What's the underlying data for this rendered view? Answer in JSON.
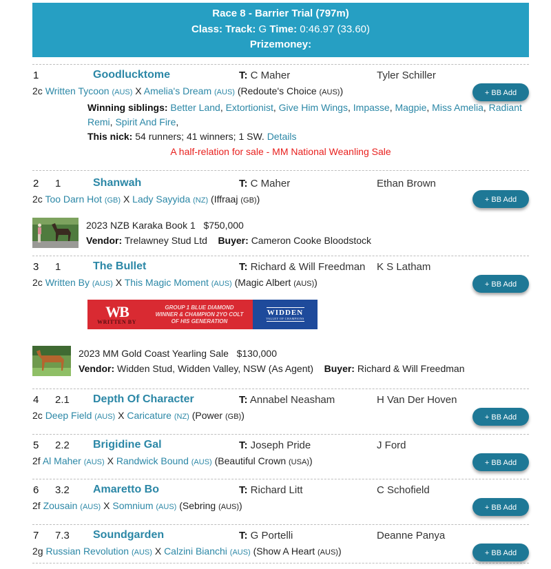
{
  "race": {
    "title": "Race 8 - Barrier Trial (797m)",
    "class_label": "Class:",
    "track_label": "Track:",
    "track_value": "G",
    "time_label": "Time:",
    "time_value": "0:46.97 (33.60)",
    "prizemoney_label": "Prizemoney:"
  },
  "labels": {
    "trainer_prefix": "T:",
    "bb_add": "+ BB Add",
    "cross": "X",
    "winning_siblings": "Winning siblings:",
    "this_nick": "This nick:",
    "details": "Details",
    "vendor": "Vendor:",
    "buyer": "Buyer:"
  },
  "colors": {
    "header_bg": "#269fc3",
    "link": "#2b87a6",
    "button_bg": "#1e7896",
    "sale_note": "#e8201e"
  },
  "runners": [
    {
      "position": "1",
      "margin": "",
      "horse": "Goodlucktome",
      "trainer": "C Maher",
      "jockey": "Tyler Schiller",
      "age_sex": "2c",
      "sire": "Written Tycoon",
      "sire_country": "(AUS)",
      "dam": "Amelia's Dream",
      "dam_country": "(AUS)",
      "damsire": "Redoute's Choice",
      "damsire_country": "(AUS)",
      "siblings": [
        "Better Land",
        "Extortionist",
        "Give Him Wings",
        "Impasse",
        "Magpie",
        "Miss Amelia",
        "Radiant Remi",
        "Spirit And Fire"
      ],
      "nick": "54 runners; 41 winners; 1 SW.",
      "sale_note": "A half-relation for sale - MM National Weanling Sale"
    },
    {
      "position": "2",
      "margin": "1",
      "horse": "Shanwah",
      "trainer": "C Maher",
      "jockey": "Ethan Brown",
      "age_sex": "2c",
      "sire": "Too Darn Hot",
      "sire_country": "(GB)",
      "dam": "Lady Sayyida",
      "dam_country": "(NZ)",
      "damsire": "Iffraaj",
      "damsire_country": "(GB)",
      "sale": {
        "name": "2023 NZB Karaka Book 1",
        "price": "$750,000",
        "vendor": "Trelawney Stud Ltd",
        "buyer": "Cameron Cooke Bloodstock"
      }
    },
    {
      "position": "3",
      "margin": "1",
      "horse": "The Bullet",
      "trainer": "Richard & Will Freedman",
      "jockey": "K S Latham",
      "age_sex": "2c",
      "sire": "Written By",
      "sire_country": "(AUS)",
      "dam": "This Magic Moment",
      "dam_country": "(AUS)",
      "damsire": "Magic Albert",
      "damsire_country": "(AUS)",
      "banner": {
        "logo": "WB",
        "logo_sub": "WRITTEN BY",
        "line1": "GROUP 1 BLUE DIAMOND",
        "line2": "WINNER & CHAMPION 2YO COLT",
        "line3": "OF HIS GENERATION",
        "stud": "WIDDEN",
        "stud_sub": "VALLEY OF CHAMPIONS"
      },
      "sale": {
        "name": "2023 MM Gold Coast Yearling Sale",
        "price": "$130,000",
        "vendor": "Widden Stud, Widden Valley, NSW (As Agent)",
        "buyer": "Richard & Will Freedman"
      }
    },
    {
      "position": "4",
      "margin": "2.1",
      "horse": "Depth Of Character",
      "trainer": "Annabel Neasham",
      "jockey": "H Van Der Hoven",
      "age_sex": "2c",
      "sire": "Deep Field",
      "sire_country": "(AUS)",
      "dam": "Caricature",
      "dam_country": "(NZ)",
      "damsire": "Power",
      "damsire_country": "(GB)"
    },
    {
      "position": "5",
      "margin": "2.2",
      "horse": "Brigidine Gal",
      "trainer": "Joseph Pride",
      "jockey": "J Ford",
      "age_sex": "2f",
      "sire": "Al Maher",
      "sire_country": "(AUS)",
      "dam": "Randwick Bound",
      "dam_country": "(AUS)",
      "damsire": "Beautiful Crown",
      "damsire_country": "(USA)"
    },
    {
      "position": "6",
      "margin": "3.2",
      "horse": "Amaretto Bo",
      "trainer": "Richard Litt",
      "jockey": "C Schofield",
      "age_sex": "2f",
      "sire": "Zousain",
      "sire_country": "(AUS)",
      "dam": "Somnium",
      "dam_country": "(AUS)",
      "damsire": "Sebring",
      "damsire_country": "(AUS)"
    },
    {
      "position": "7",
      "margin": "7.3",
      "horse": "Soundgarden",
      "trainer": "G Portelli",
      "jockey": "Deanne Panya",
      "age_sex": "2g",
      "sire": "Russian Revolution",
      "sire_country": "(AUS)",
      "dam": "Calzini Bianchi",
      "dam_country": "(AUS)",
      "damsire": "Show A Heart",
      "damsire_country": "(AUS)"
    }
  ]
}
